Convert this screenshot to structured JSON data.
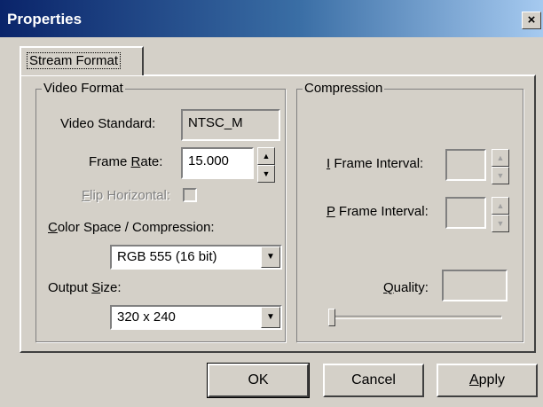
{
  "window": {
    "title": "Properties",
    "close_glyph": "×"
  },
  "tabs": [
    {
      "label": "Stream Format"
    }
  ],
  "video_format": {
    "group_title": "Video Format",
    "video_standard": {
      "label": "Video Standard:",
      "value": "NTSC_M"
    },
    "frame_rate": {
      "label_pre": "Frame ",
      "label_key": "R",
      "label_post": "ate:",
      "value": "15.000"
    },
    "flip_horizontal": {
      "label_key": "F",
      "label_post": "lip Horizontal:",
      "checked": false,
      "enabled": false
    },
    "color_space": {
      "label_key": "C",
      "label_post": "olor Space / Compression:",
      "selected": "RGB 555 (16 bit)"
    },
    "output_size": {
      "label_pre": "Output ",
      "label_key": "S",
      "label_post": "ize:",
      "selected": "320 x 240"
    }
  },
  "compression": {
    "group_title": "Compression",
    "i_frame": {
      "label_key": "I",
      "label_post": " Frame Interval:",
      "value": ""
    },
    "p_frame": {
      "label_key": "P",
      "label_post": " Frame Interval:",
      "value": ""
    },
    "quality": {
      "label_key": "Q",
      "label_post": "uality:",
      "value": "",
      "slider_level": 0
    }
  },
  "buttons": {
    "ok": "OK",
    "cancel": "Cancel",
    "apply_key": "A",
    "apply_post": "pply"
  },
  "icons": {
    "spin_up": "▲",
    "spin_down": "▼",
    "dropdown": "▼"
  },
  "colors": {
    "face": "#d4d0c8",
    "title_start": "#0a246a",
    "title_end": "#a6caf0"
  }
}
